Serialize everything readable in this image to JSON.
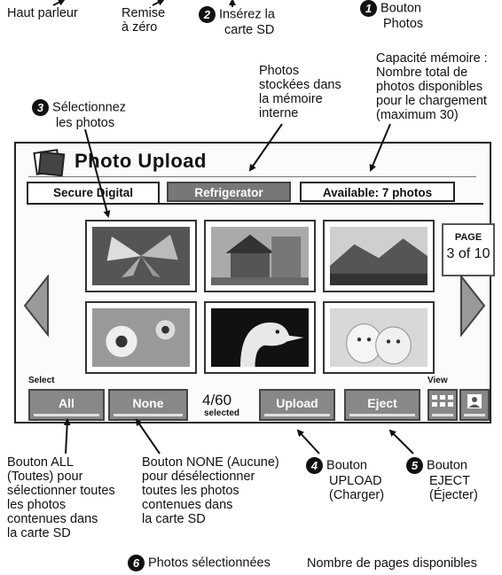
{
  "annotations": {
    "speaker": "Haut parleur",
    "reset": [
      "Remise",
      "à zéro"
    ],
    "insert_sd": {
      "num": "2",
      "lines": [
        "Insérez la",
        "carte SD"
      ]
    },
    "photos_button": {
      "num": "1",
      "lines": [
        "Bouton",
        "Photos"
      ]
    },
    "internal_memory": [
      "Photos",
      "stockées dans",
      "la mémoire",
      "interne"
    ],
    "capacity": [
      "Capacité mémoire :",
      "Nombre total de",
      "photos disponibles",
      "pour le chargement",
      "(maximum 30)"
    ],
    "select_photos": {
      "num": "3",
      "lines": [
        "Sélectionnez",
        "les photos"
      ]
    },
    "all_button": [
      "Bouton ALL",
      "(Toutes) pour",
      "sélectionner toutes",
      "les photos",
      "contenues dans",
      "la carte SD"
    ],
    "none_button": [
      "Bouton NONE (Aucune)",
      "pour désélectionner",
      "toutes les photos",
      "contenues dans",
      "la carte SD"
    ],
    "upload_button": {
      "num": "4",
      "lines": [
        "Bouton",
        "UPLOAD",
        "(Charger)"
      ]
    },
    "eject_button": {
      "num": "5",
      "lines": [
        "Bouton",
        "EJECT",
        "(Éjecter)"
      ]
    },
    "selected_photos": {
      "num": "6",
      "text": "Photos sélectionnées"
    },
    "pages_available": "Nombre de pages disponibles"
  },
  "screen": {
    "title": "Photo Upload",
    "tabs": {
      "sd": "Secure Digital",
      "fridge": "Refrigerator",
      "available": "Available: 7 photos"
    },
    "page": {
      "label": "PAGE",
      "value": "3 of 10"
    },
    "select_label": "Select",
    "view_label": "View",
    "buttons": {
      "all": "All",
      "none": "None",
      "upload": "Upload",
      "eject": "Eject"
    },
    "count": "4/60",
    "count_sub": "selected",
    "thumbnails": [
      "butterfly",
      "house",
      "landscape",
      "flowers",
      "bird",
      "puppies"
    ]
  },
  "colors": {
    "button_gray": "#888888",
    "screen_bg": "#fbfbfb",
    "ink": "#111111"
  }
}
